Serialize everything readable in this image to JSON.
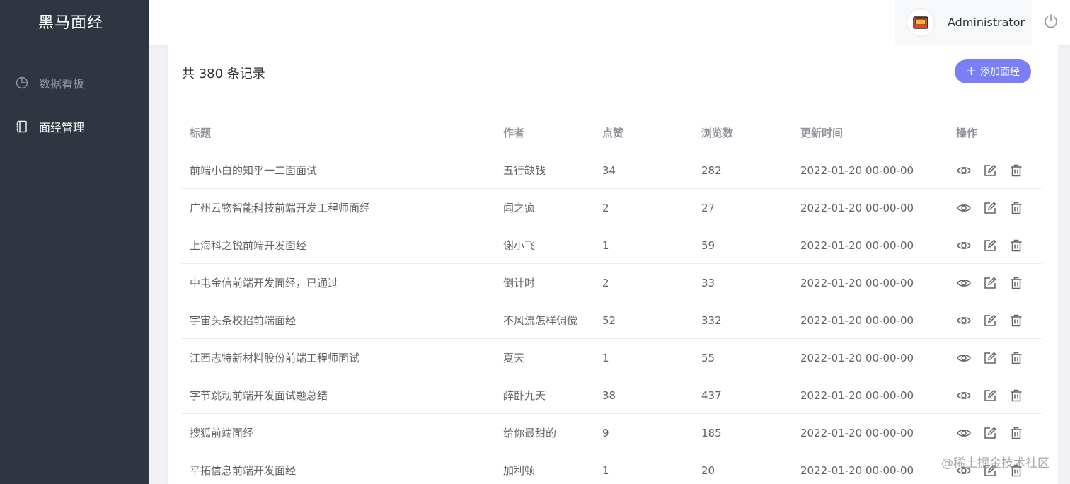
{
  "app": {
    "logo": "黑马面经"
  },
  "sidebar": {
    "items": [
      {
        "label": "数据看板",
        "icon": "pie-chart-icon",
        "active": false
      },
      {
        "label": "面经管理",
        "icon": "notebook-icon",
        "active": true
      }
    ]
  },
  "header": {
    "username": "Administrator",
    "avatar_icon": "avatar-icon",
    "logout_icon": "power-icon"
  },
  "main": {
    "record_count": "共 380 条记录",
    "add_button": "添加面经",
    "accent_color": "#7b7ff6",
    "table": {
      "columns": [
        "标题",
        "作者",
        "点赞",
        "浏览数",
        "更新时间",
        "操作"
      ],
      "rows": [
        {
          "title": "前端小白的知乎一二面面试",
          "author": "五行缺钱",
          "likes": "34",
          "views": "282",
          "updated": "2022-01-20 00-00-00"
        },
        {
          "title": "广州云物智能科技前端开发工程师面经",
          "author": "闻之疯",
          "likes": "2",
          "views": "27",
          "updated": "2022-01-20 00-00-00"
        },
        {
          "title": "上海科之锐前端开发面经",
          "author": "谢小飞",
          "likes": "1",
          "views": "59",
          "updated": "2022-01-20 00-00-00"
        },
        {
          "title": "中电金信前端开发面经，已通过",
          "author": "倒计时",
          "likes": "2",
          "views": "33",
          "updated": "2022-01-20 00-00-00"
        },
        {
          "title": "宇宙头条校招前端面经",
          "author": "不风流怎样倜傥",
          "likes": "52",
          "views": "332",
          "updated": "2022-01-20 00-00-00"
        },
        {
          "title": "江西志特新材料股份前端工程师面试",
          "author": "夏天",
          "likes": "1",
          "views": "55",
          "updated": "2022-01-20 00-00-00"
        },
        {
          "title": "字节跳动前端开发面试题总结",
          "author": "醉卧九天",
          "likes": "38",
          "views": "437",
          "updated": "2022-01-20 00-00-00"
        },
        {
          "title": "搜狐前端面经",
          "author": "给你最甜的",
          "likes": "9",
          "views": "185",
          "updated": "2022-01-20 00-00-00"
        },
        {
          "title": "平拓信息前端开发面经",
          "author": "加利顿",
          "likes": "1",
          "views": "20",
          "updated": "2022-01-20 00-00-00"
        }
      ],
      "row_actions": [
        "view-icon",
        "edit-icon",
        "delete-icon"
      ]
    }
  },
  "watermark": "@稀土掘金技术社区"
}
